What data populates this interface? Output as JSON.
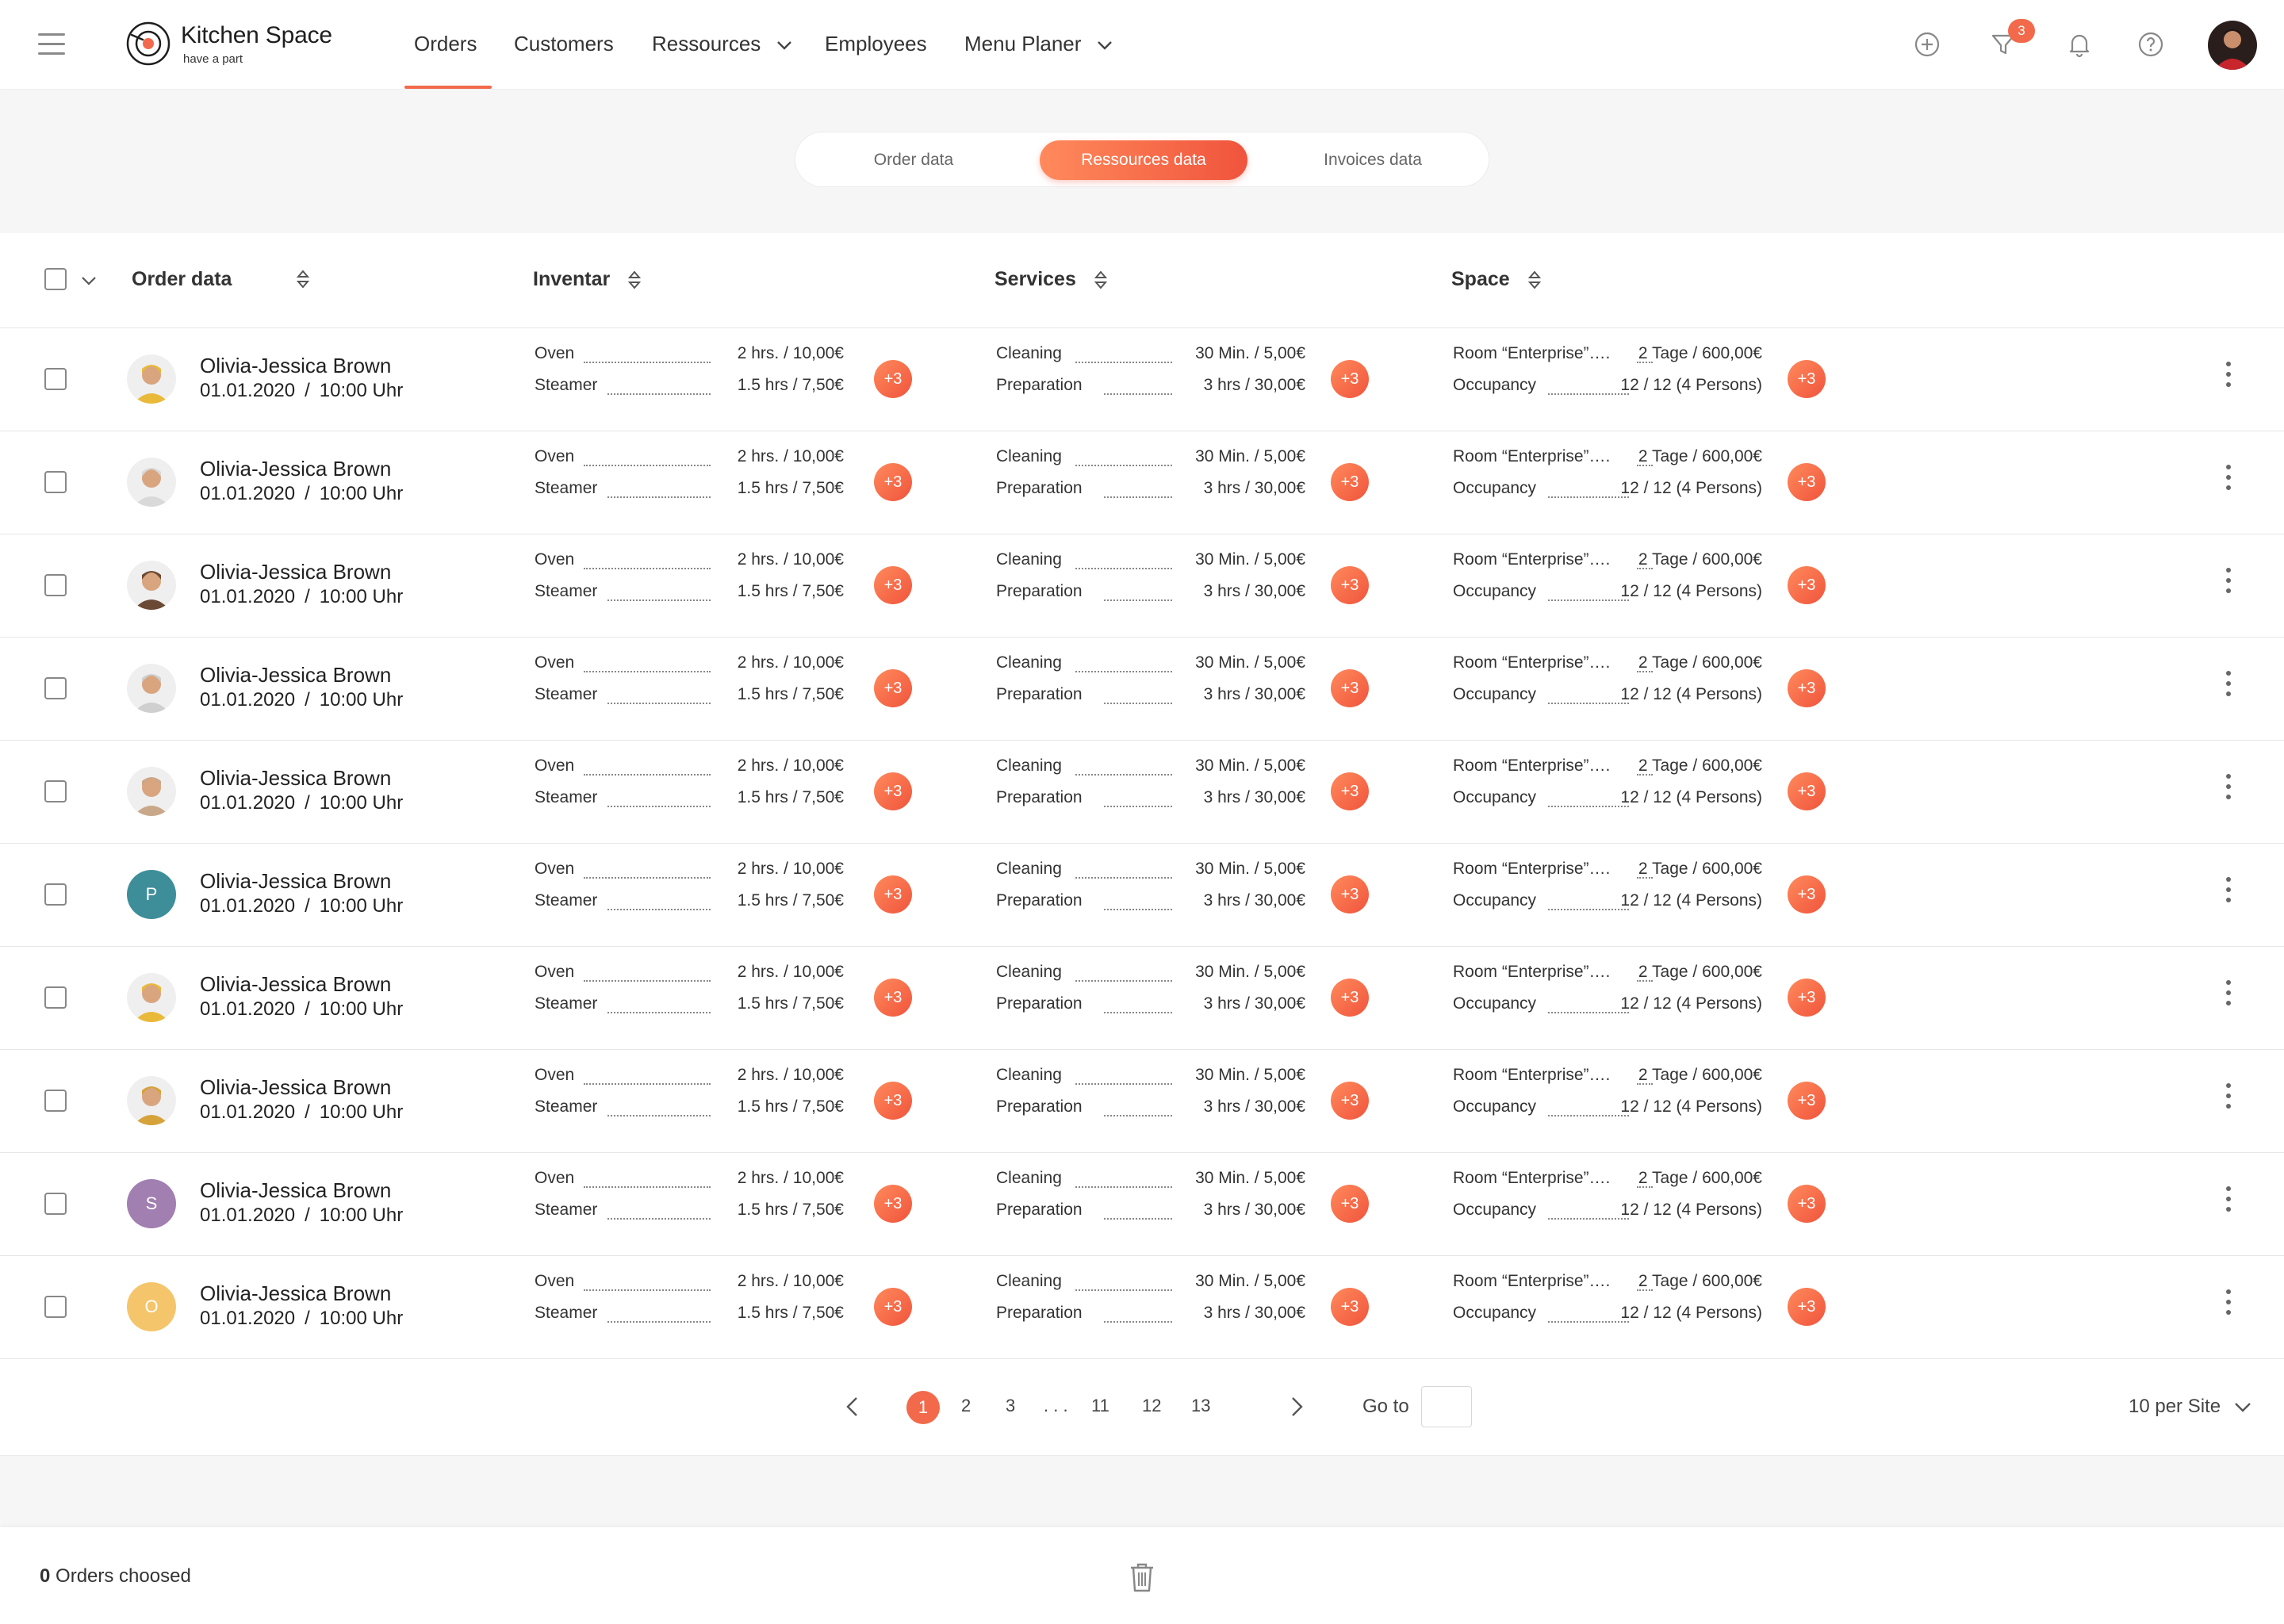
{
  "app": {
    "name": "Kitchen Space",
    "tagline": "have a part",
    "accent": "#f26a4b"
  },
  "nav": {
    "items": [
      {
        "label": "Orders",
        "active": true,
        "has_dropdown": false
      },
      {
        "label": "Customers",
        "active": false,
        "has_dropdown": false
      },
      {
        "label": "Ressources",
        "active": false,
        "has_dropdown": true
      },
      {
        "label": "Employees",
        "active": false,
        "has_dropdown": false
      },
      {
        "label": "Menu Planer",
        "active": false,
        "has_dropdown": true
      }
    ],
    "icons": [
      "plus-circle-icon",
      "filter-icon",
      "bell-icon",
      "help-icon"
    ],
    "filter_badge": "3"
  },
  "tabs": [
    {
      "label": "Order data",
      "active": false
    },
    {
      "label": "Ressources data",
      "active": true
    },
    {
      "label": "Invoices data",
      "active": false
    }
  ],
  "table": {
    "headers": {
      "order": "Order data",
      "inventar": "Inventar",
      "services": "Services",
      "space": "Space"
    },
    "rows": [
      {
        "name": "Olivia-Jessica Brown",
        "date": "01.01.2020",
        "time": "10:00 Uhr",
        "avatar": "photo",
        "avatar_color": "#e9b93a"
      },
      {
        "name": "Olivia-Jessica Brown",
        "date": "01.01.2020",
        "time": "10:00 Uhr",
        "avatar": "photo",
        "avatar_color": "#d9d9d9"
      },
      {
        "name": "Olivia-Jessica Brown",
        "date": "01.01.2020",
        "time": "10:00 Uhr",
        "avatar": "photo",
        "avatar_color": "#6b4a35"
      },
      {
        "name": "Olivia-Jessica Brown",
        "date": "01.01.2020",
        "time": "10:00 Uhr",
        "avatar": "photo",
        "avatar_color": "#cfcfcf"
      },
      {
        "name": "Olivia-Jessica Brown",
        "date": "01.01.2020",
        "time": "10:00 Uhr",
        "avatar": "photo",
        "avatar_color": "#c9a88a"
      },
      {
        "name": "Olivia-Jessica Brown",
        "date": "01.01.2020",
        "time": "10:00 Uhr",
        "avatar": "letter",
        "letter": "P",
        "avatar_color": "#3e8e9a"
      },
      {
        "name": "Olivia-Jessica Brown",
        "date": "01.01.2020",
        "time": "10:00 Uhr",
        "avatar": "photo",
        "avatar_color": "#e9b93a"
      },
      {
        "name": "Olivia-Jessica Brown",
        "date": "01.01.2020",
        "time": "10:00 Uhr",
        "avatar": "photo",
        "avatar_color": "#d6a23a"
      },
      {
        "name": "Olivia-Jessica Brown",
        "date": "01.01.2020",
        "time": "10:00 Uhr",
        "avatar": "letter",
        "letter": "S",
        "avatar_color": "#a17fb0"
      },
      {
        "name": "Olivia-Jessica Brown",
        "date": "01.01.2020",
        "time": "10:00 Uhr",
        "avatar": "letter",
        "letter": "O",
        "avatar_color": "#f5c56b"
      }
    ],
    "inventar": [
      {
        "label": "Oven",
        "value": "2 hrs. / 10,00€"
      },
      {
        "label": "Steamer",
        "value": "1.5 hrs / 7,50€"
      }
    ],
    "services": [
      {
        "label": "Cleaning",
        "value": "30 Min. / 5,00€"
      },
      {
        "label": "Preparation",
        "value": "3 hrs / 30,00€"
      }
    ],
    "space": [
      {
        "label": "Room “Enterprise”….",
        "value": "2 Tage  /  600,00€"
      },
      {
        "label": "Occupancy",
        "value": "12 / 12 (4 Persons)"
      }
    ],
    "more_badge": "+3"
  },
  "pagination": {
    "pages": [
      "1",
      "2",
      "3",
      ". . .",
      "11",
      "12",
      "13"
    ],
    "current": "1",
    "goto_label": "Go to",
    "per_site": "10 per Site"
  },
  "footer": {
    "count": "0",
    "label": "Orders choosed"
  }
}
